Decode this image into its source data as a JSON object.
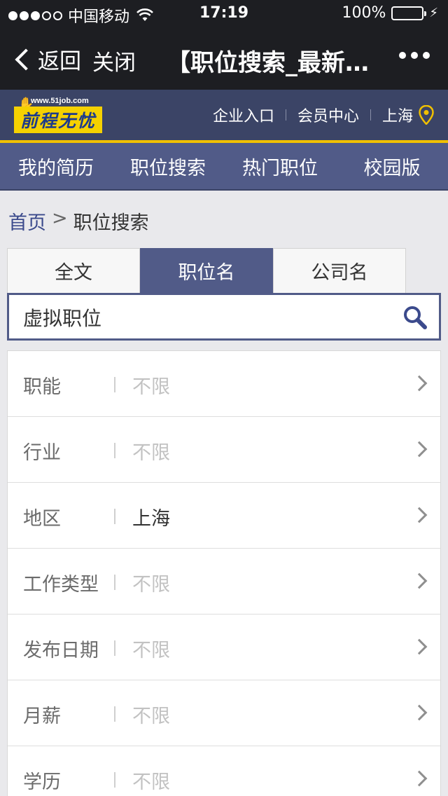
{
  "status_bar": {
    "carrier": "中国移动",
    "time": "17:19",
    "battery": "100%",
    "battery_level": 1.0
  },
  "nav": {
    "back_label": "返回",
    "close_label": "关闭",
    "title": "【职位搜索_最新…"
  },
  "site_header": {
    "logo_url": "www.51job.com",
    "logo_text": "前程无忧",
    "links": [
      "企业入口",
      "会员中心",
      "上海"
    ]
  },
  "menu": [
    "我的简历",
    "职位搜索",
    "热门职位",
    "校园版"
  ],
  "breadcrumb": {
    "home": "首页",
    "separator": ">",
    "current": "职位搜索"
  },
  "tabs": [
    {
      "label": "全文",
      "active": false
    },
    {
      "label": "职位名",
      "active": true
    },
    {
      "label": "公司名",
      "active": false
    }
  ],
  "search": {
    "value": "虚拟职位"
  },
  "filters": [
    {
      "label": "职能",
      "value": "不限"
    },
    {
      "label": "行业",
      "value": "不限"
    },
    {
      "label": "地区",
      "value": "上海"
    },
    {
      "label": "工作类型",
      "value": "不限"
    },
    {
      "label": "发布日期",
      "value": "不限"
    },
    {
      "label": "月薪",
      "value": "不限"
    },
    {
      "label": "学历",
      "value": "不限"
    }
  ],
  "colors": {
    "header_bg": "#3b4466",
    "menu_bg": "#515b88",
    "accent_yellow": "#f0c000",
    "battery_green": "#4cd964"
  }
}
